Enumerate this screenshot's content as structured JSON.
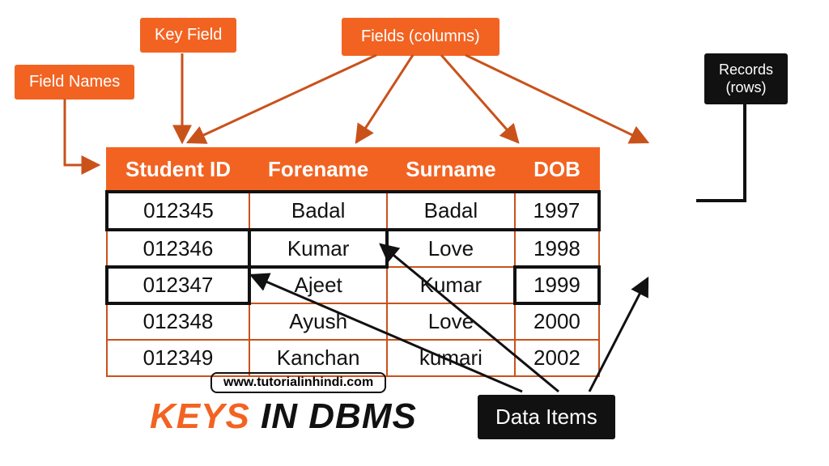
{
  "labels": {
    "field_names": "Field Names",
    "key_field": "Key Field",
    "fields_columns": "Fields (columns)",
    "records_rows": "Records\n(rows)",
    "data_items": "Data Items"
  },
  "columns": [
    "Student ID",
    "Forename",
    "Surname",
    "DOB"
  ],
  "rows": [
    {
      "id": "012345",
      "forename": "Badal",
      "surname": "Badal",
      "dob": "1997"
    },
    {
      "id": "012346",
      "forename": "Kumar",
      "surname": "Love",
      "dob": "1998"
    },
    {
      "id": "012347",
      "forename": "Ajeet",
      "surname": "Kumar",
      "dob": "1999"
    },
    {
      "id": "012348",
      "forename": "Ayush",
      "surname": "Love",
      "dob": "2000"
    },
    {
      "id": "012349",
      "forename": "Kanchan",
      "surname": "kumari",
      "dob": "2002"
    }
  ],
  "url": "www.tutorialinhindi.com",
  "title": {
    "part1": "KEYS ",
    "part2": "IN DBMS"
  },
  "highlights": {
    "row_index": 0,
    "cells": [
      {
        "row": 2,
        "col": 0
      },
      {
        "row": 1,
        "col": 1
      },
      {
        "row": 2,
        "col": 3
      }
    ]
  },
  "colors": {
    "accent": "#f26322",
    "dark": "#111111"
  }
}
